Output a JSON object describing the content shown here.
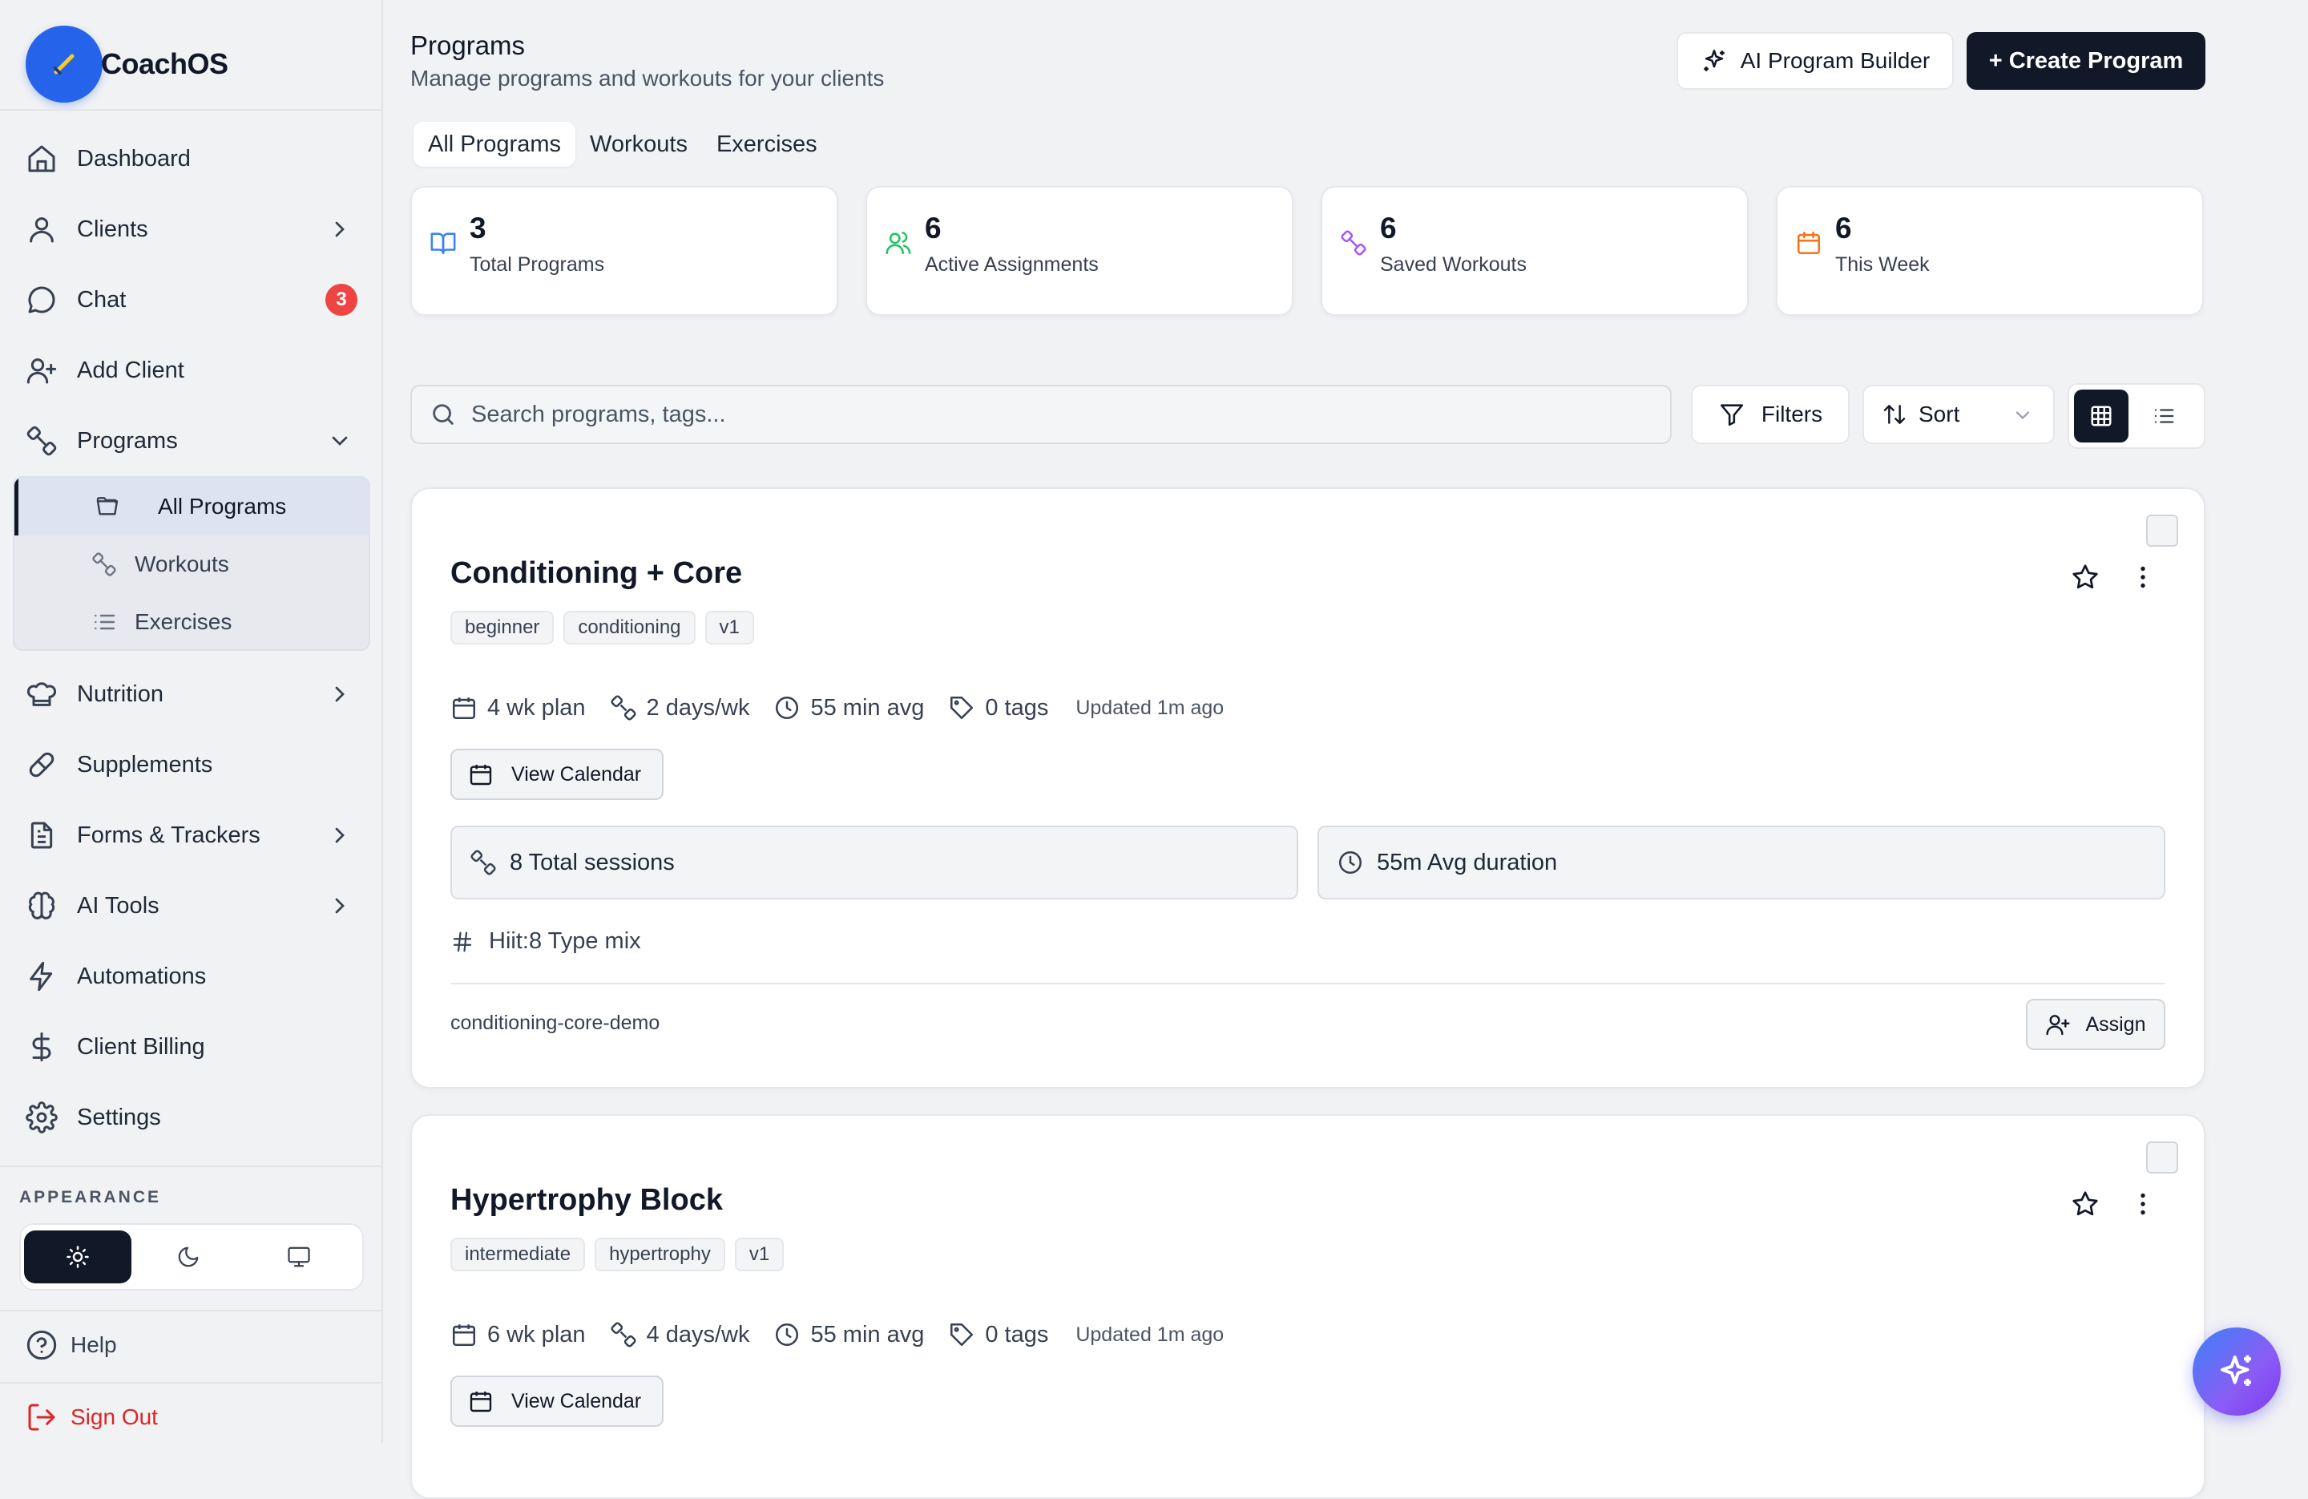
{
  "brand": {
    "name": "CoachOS"
  },
  "sidebar": {
    "items": [
      {
        "label": "Dashboard"
      },
      {
        "label": "Clients"
      },
      {
        "label": "Chat",
        "badge": "3"
      },
      {
        "label": "Add Client"
      },
      {
        "label": "Programs"
      },
      {
        "label": "Nutrition"
      },
      {
        "label": "Supplements"
      },
      {
        "label": "Forms & Trackers"
      },
      {
        "label": "AI Tools"
      },
      {
        "label": "Automations"
      },
      {
        "label": "Client Billing"
      },
      {
        "label": "Settings"
      }
    ],
    "programs_sub": [
      {
        "label": "All Programs"
      },
      {
        "label": "Workouts"
      },
      {
        "label": "Exercises"
      }
    ],
    "appearance_label": "APPEARANCE",
    "help": "Help",
    "sign_out": "Sign Out"
  },
  "header": {
    "title": "Programs",
    "subtitle": "Manage programs and workouts for your clients",
    "ai_builder": "AI Program Builder",
    "create": "+ Create Program"
  },
  "tabs": [
    {
      "label": "All Programs"
    },
    {
      "label": "Workouts"
    },
    {
      "label": "Exercises"
    }
  ],
  "stats": [
    {
      "value": "3",
      "label": "Total Programs",
      "color": "#3b82f6"
    },
    {
      "value": "6",
      "label": "Active Assignments",
      "color": "#22c55e"
    },
    {
      "value": "6",
      "label": "Saved Workouts",
      "color": "#a855f7"
    },
    {
      "value": "6",
      "label": "This Week",
      "color": "#f97316"
    }
  ],
  "toolbar": {
    "search_placeholder": "Search programs, tags...",
    "filters": "Filters",
    "sort": "Sort"
  },
  "programs": [
    {
      "title": "Conditioning + Core",
      "tags": [
        "beginner",
        "conditioning",
        "v1"
      ],
      "weeks": "4 wk plan",
      "days": "2 days/wk",
      "avg": "55 min avg",
      "tag_count": "0 tags",
      "updated": "Updated 1m ago",
      "view_calendar": "View Calendar",
      "sessions": "8 Total sessions",
      "duration": "55m Avg duration",
      "type_mix": "Hiit:8 Type mix",
      "slug": "conditioning-core-demo",
      "assign": "Assign"
    },
    {
      "title": "Hypertrophy Block",
      "tags": [
        "intermediate",
        "hypertrophy",
        "v1"
      ],
      "weeks": "6 wk plan",
      "days": "4 days/wk",
      "avg": "55 min avg",
      "tag_count": "0 tags",
      "updated": "Updated 1m ago",
      "view_calendar": "View Calendar"
    }
  ]
}
